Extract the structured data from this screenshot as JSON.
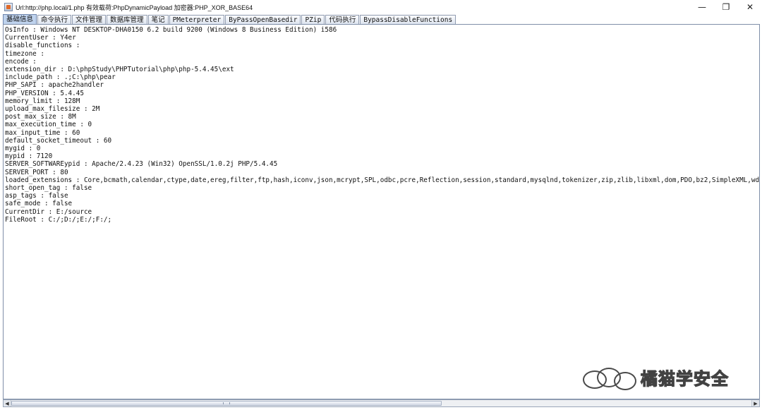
{
  "window": {
    "title": "Url:http://php.local/1.php 有效载荷:PhpDynamicPayload 加密器:PHP_XOR_BASE64",
    "minimize_glyph": "—",
    "maximize_glyph": "❐",
    "close_glyph": "✕"
  },
  "tabs": [
    {
      "label": "基础信息",
      "active": true
    },
    {
      "label": "命令执行"
    },
    {
      "label": "文件管理"
    },
    {
      "label": "数据库管理"
    },
    {
      "label": "笔记"
    },
    {
      "label": "PMeterpreter"
    },
    {
      "label": "ByPassOpenBasedir"
    },
    {
      "label": "PZip"
    },
    {
      "label": "代码执行"
    },
    {
      "label": "BypassDisableFunctions"
    }
  ],
  "info_lines": [
    "OsInfo : Windows NT DESKTOP-DHA0150 6.2 build 9200 (Windows 8 Business Edition) i586",
    "CurrentUser : Y4er",
    "disable_functions :",
    "timezone :",
    "encode :",
    "extension_dir : D:\\phpStudy\\PHPTutorial\\php\\php-5.4.45\\ext",
    "include_path : .;C:\\php\\pear",
    "PHP_SAPI : apache2handler",
    "PHP_VERSION : 5.4.45",
    "memory_limit : 128M",
    "upload_max_filesize : 2M",
    "post_max_size : 8M",
    "max_execution_time : 0",
    "max_input_time : 60",
    "default_socket_timeout : 60",
    "mygid : 0",
    "mypid : 7120",
    "SERVER_SOFTWAREypid : Apache/2.4.23 (Win32) OpenSSL/1.0.2j PHP/5.4.45",
    "SERVER_PORT : 80",
    "loaded_extensions : Core,bcmath,calendar,ctype,date,ereg,filter,ftp,hash,iconv,json,mcrypt,SPL,odbc,pcre,Reflection,session,standard,mysqlnd,tokenizer,zip,zlib,libxml,dom,PDO,bz2,SimpleXML,wd",
    "short_open_tag : false",
    "asp_tags : false",
    "safe_mode : false",
    "CurrentDir : E:/source",
    "FileRoot : C:/;D:/;E:/;F:/;"
  ],
  "scrollbar": {
    "left_arrow": "◀",
    "right_arrow": "▶"
  },
  "watermark": {
    "text": "橘猫学安全"
  }
}
